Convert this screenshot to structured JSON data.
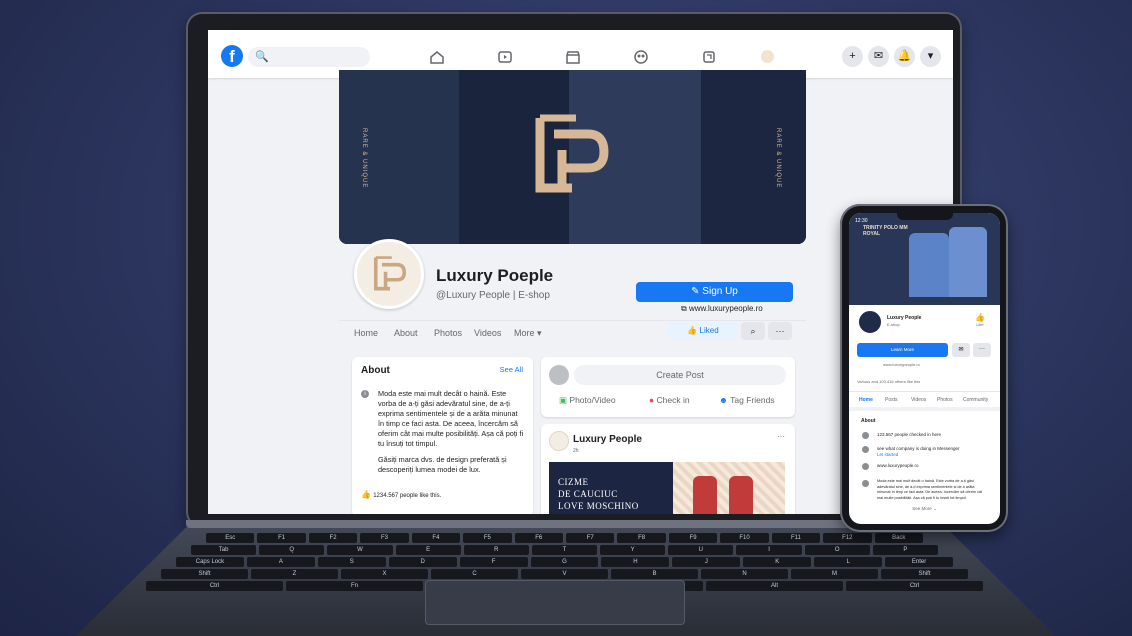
{
  "laptop": {
    "nav": {
      "logo": "f",
      "search_icon": "🔍",
      "icons": [
        "home-icon",
        "watch-icon",
        "marketplace-icon",
        "groups-icon",
        "gaming-icon"
      ],
      "right_icons": [
        "+",
        "✉",
        "🔔",
        "▾"
      ]
    },
    "cover": {
      "side_text_left": "RARE & UNIQUE",
      "side_text_right": "RARE & UNIQUE",
      "monogram": "LP"
    },
    "profile": {
      "name": "Luxury Poeple",
      "handle": "@Luxury People | E-shop",
      "signup_label": "Sign Up",
      "website": "www.luxurypeople.ro"
    },
    "tabs": [
      "Home",
      "About",
      "Photos",
      "Videos",
      "More"
    ],
    "liked_label": "Liked",
    "about": {
      "title": "About",
      "see_all": "See All",
      "text1": "Moda este mai mult decât o haină. Este vorba de a-ți găsi adevăratul sine, de a-ți exprima sentimentele și de a arăta minunat în timp ce faci asta. De aceea, încercăm să oferim cât mai multe posibilități. Așa că poți fi tu însuți tot timpul.",
      "text2": "Găsiți marca dvs. de design preferată și descoperiți lumea modei de lux.",
      "likes": "1234.567 people like this."
    },
    "composer": {
      "create_post": "Create Post",
      "photo_video": "Photo/Video",
      "check_in": "Check in",
      "tag_friends": "Tag Friends"
    },
    "post": {
      "name": "Luxury People",
      "meta": "2h",
      "more": "···",
      "image_text": [
        "CIZME",
        "DE CAUCIUC",
        "LOVE MOSCHINO"
      ]
    }
  },
  "keyboard": {
    "row1": [
      "Esc",
      "F1",
      "F2",
      "F3",
      "F4",
      "F5",
      "F6",
      "F7",
      "F8",
      "F9",
      "F10",
      "F11",
      "F12",
      "Back"
    ],
    "row2": [
      "Tab",
      "Q",
      "W",
      "E",
      "R",
      "T",
      "Y",
      "U",
      "I",
      "O",
      "P"
    ],
    "row3": [
      "Caps Lock",
      "A",
      "S",
      "D",
      "F",
      "G",
      "H",
      "J",
      "K",
      "L",
      "Enter"
    ],
    "row4": [
      "Shift",
      "Z",
      "X",
      "C",
      "V",
      "B",
      "N",
      "M",
      "Shift"
    ],
    "row5": [
      "Ctrl",
      "Fn",
      "Alt",
      "",
      "Alt",
      "Ctrl"
    ]
  },
  "phone": {
    "time": "12:30",
    "cover_text": "TRINITY POLO MM ROYAL",
    "name": "Luxury People",
    "sub": "E-shop",
    "like_label": "Like",
    "learn_more": "Learn More",
    "website": "www.luxurypeople.ro",
    "followers": "Various and 103.416 others like this",
    "tabs": [
      "Home",
      "Posts",
      "Videos",
      "Photos",
      "Community"
    ],
    "about_title": "About",
    "rows": [
      "123.567 people checked in here",
      "see what company is doing in Messenger",
      "Let started",
      "www.luxurypeople.ro"
    ],
    "about_text": "Moda este mai mult decât o haină. Este vorba de a-ți găsi adevăratul sine, de a-ți exprima sentimentele și de a arăta minunat în timp ce faci asta. De aceea, încercăm să oferim cât mai multe posibilități. Așa că poți fi tu însuți tot timpul.",
    "see_more": "See More"
  }
}
